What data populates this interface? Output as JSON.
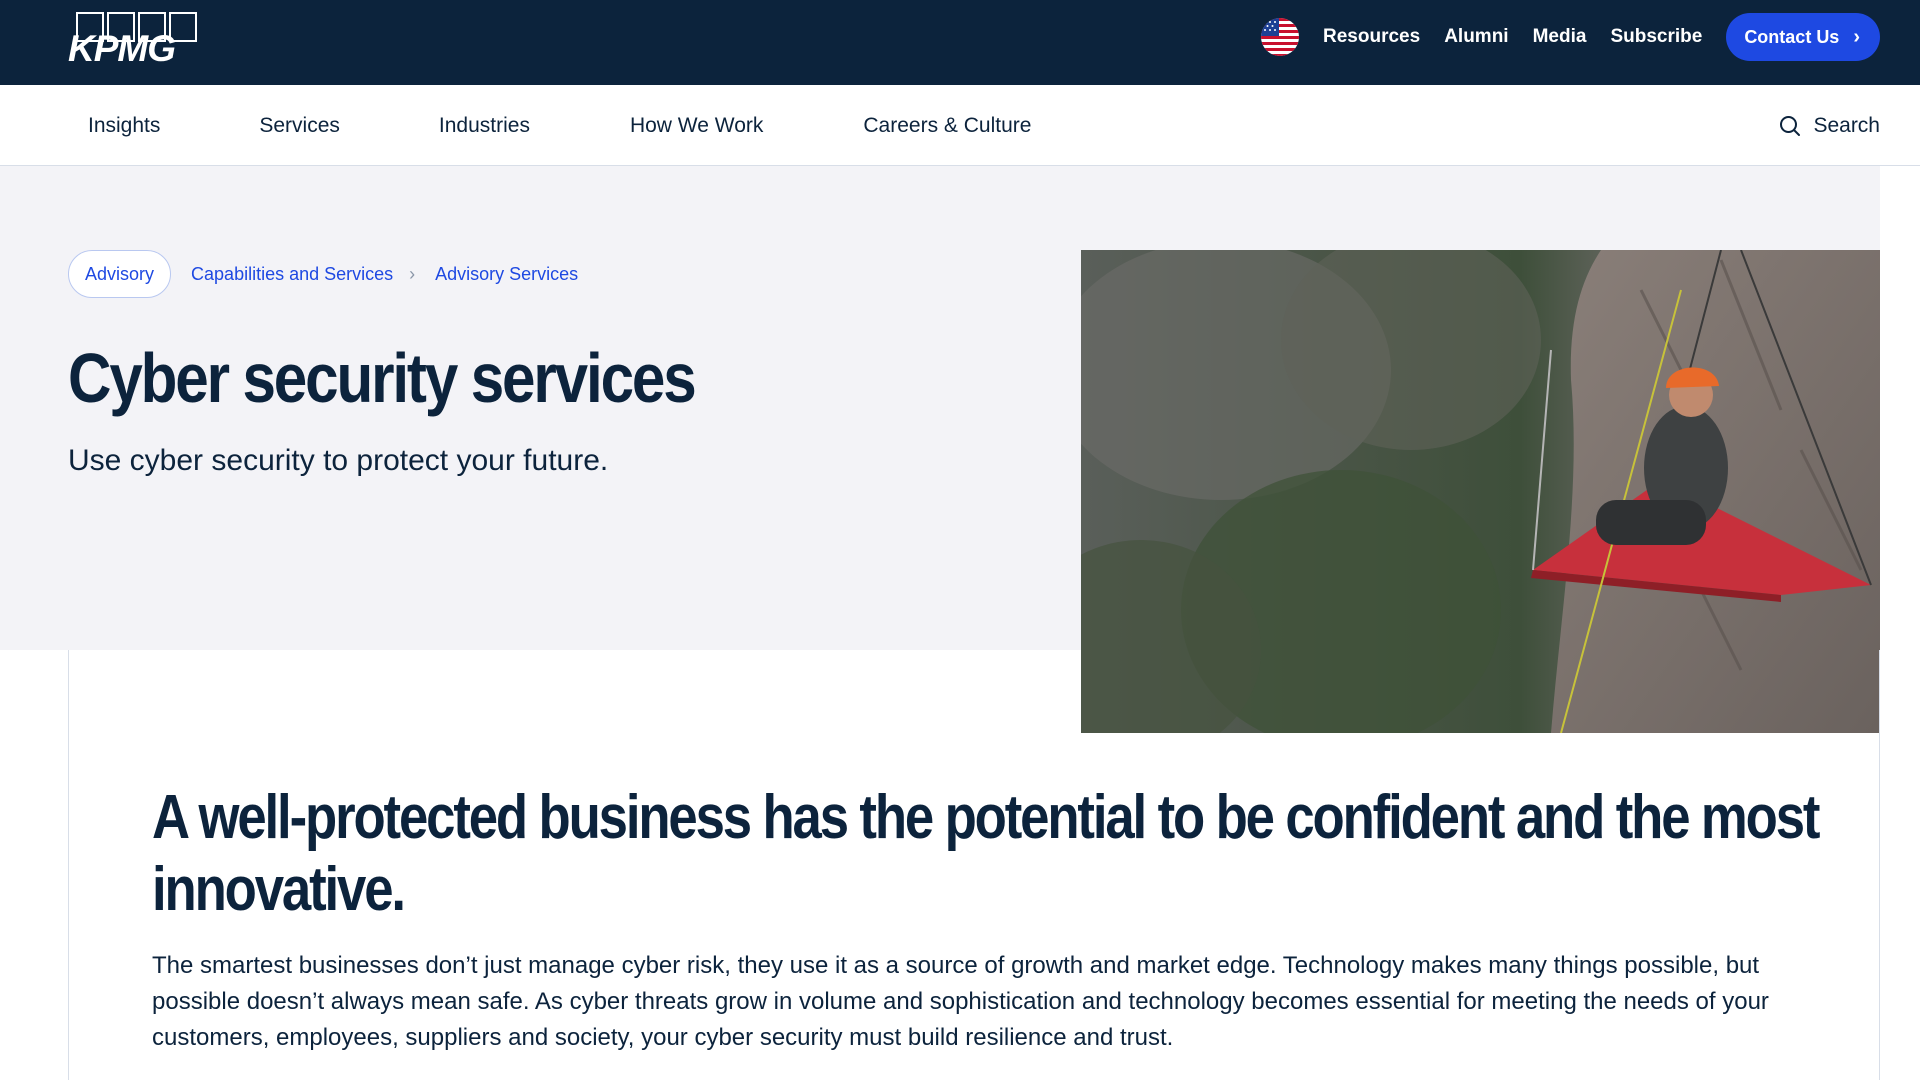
{
  "header": {
    "logo_text": "KPMG",
    "utility_links": [
      "Resources",
      "Alumni",
      "Media",
      "Subscribe"
    ],
    "contact_label": "Contact Us",
    "flag_icon": "us-flag-icon"
  },
  "nav": {
    "items": [
      "Insights",
      "Services",
      "Industries",
      "How We Work",
      "Careers & Culture"
    ],
    "search_label": "Search"
  },
  "breadcrumb": {
    "items": [
      "Advisory",
      "Capabilities and Services",
      "Advisory Services"
    ]
  },
  "hero": {
    "title": "Cyber security services",
    "subtitle": "Use cyber security to protect your future."
  },
  "content": {
    "heading_line1": "A well-protected business has the potential to be confident and the most",
    "heading_line2": "innovative.",
    "body": "The smartest businesses don’t just manage cyber risk, they use it as a source of growth and market edge. Technology makes many things possible, but possible doesn’t always mean safe. As cyber threats grow in volume and sophistication and technology becomes essential for meeting the needs of your customers, employees, suppliers and society, your cyber security must build resilience and trust."
  },
  "colors": {
    "navy": "#0c233c",
    "accent_blue": "#1e49e2",
    "hero_bg": "#f3f3f7"
  }
}
